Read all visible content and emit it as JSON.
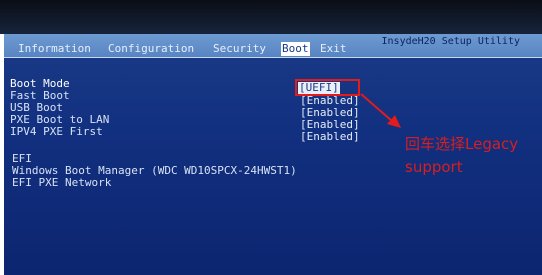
{
  "bios": {
    "title": "InsydeH20 Setup Utility",
    "menu": [
      {
        "label": "Information",
        "active": false
      },
      {
        "label": "Configuration",
        "active": false
      },
      {
        "label": "Security",
        "active": false
      },
      {
        "label": "Boot",
        "active": true
      },
      {
        "label": "Exit",
        "active": false
      }
    ],
    "settings": [
      {
        "label": "Boot Mode",
        "value": "[UEFI]",
        "selected": true
      },
      {
        "label": "Fast Boot",
        "value": "[Enabled]",
        "selected": false
      },
      {
        "label": "USB Boot",
        "value": "[Enabled]",
        "selected": false
      },
      {
        "label": "PXE Boot to LAN",
        "value": "[Enabled]",
        "selected": false
      },
      {
        "label": "IPV4 PXE First",
        "value": "[Enabled]",
        "selected": false
      }
    ],
    "efi_header": "EFI",
    "efi_entries": [
      "Windows Boot Manager (WDC WD10SPCX-24HWST1)",
      "EFI PXE Network"
    ]
  },
  "annotation": {
    "line1": "回车选择Legacy",
    "line2": "support",
    "color": "#d81e1e"
  }
}
